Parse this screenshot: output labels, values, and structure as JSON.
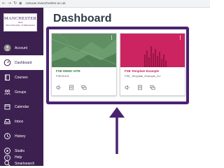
{
  "browser": {
    "url": "canvas.manchester.ac.uk",
    "back_icon": "arrow-left-icon",
    "forward_icon": "arrow-right-icon",
    "reload_icon": "reload-icon"
  },
  "logo": {
    "name": "MANCHESTER",
    "year": "1824",
    "subtitle": "The University of Manchester"
  },
  "sidebar": {
    "items": [
      {
        "label": "Account",
        "icon": "avatar-icon",
        "active": false
      },
      {
        "label": "Dashboard",
        "icon": "speedometer-icon",
        "active": true
      },
      {
        "label": "Courses",
        "icon": "book-icon",
        "active": false
      },
      {
        "label": "Groups",
        "icon": "people-icon",
        "active": false
      },
      {
        "label": "Calendar",
        "icon": "calendar-icon",
        "active": false
      },
      {
        "label": "Inbox",
        "icon": "inbox-icon",
        "active": false
      },
      {
        "label": "History",
        "icon": "clock-icon",
        "active": false
      },
      {
        "label": "Studio",
        "icon": "studio-icon",
        "active": false
      },
      {
        "label": "Smartsearch",
        "icon": "magnifier-icon",
        "active": false
      },
      {
        "label": "Help",
        "icon": "help-icon",
        "active": false
      }
    ]
  },
  "main": {
    "title": "Dashboard"
  },
  "cards": [
    {
      "title": "FSE DEMO SITE",
      "code": "FSE20101",
      "accent": "#4f8a5a",
      "title_color": "#2e7a3a"
    },
    {
      "title": "FSE Template Example",
      "code": "FSE_Template_Example_D1",
      "accent": "#c01e5a",
      "title_color": "#c01e5a"
    }
  ],
  "colors": {
    "sidebar_bg": "#3c2150",
    "highlight": "#4a2370",
    "title_text": "#2d3b45"
  }
}
